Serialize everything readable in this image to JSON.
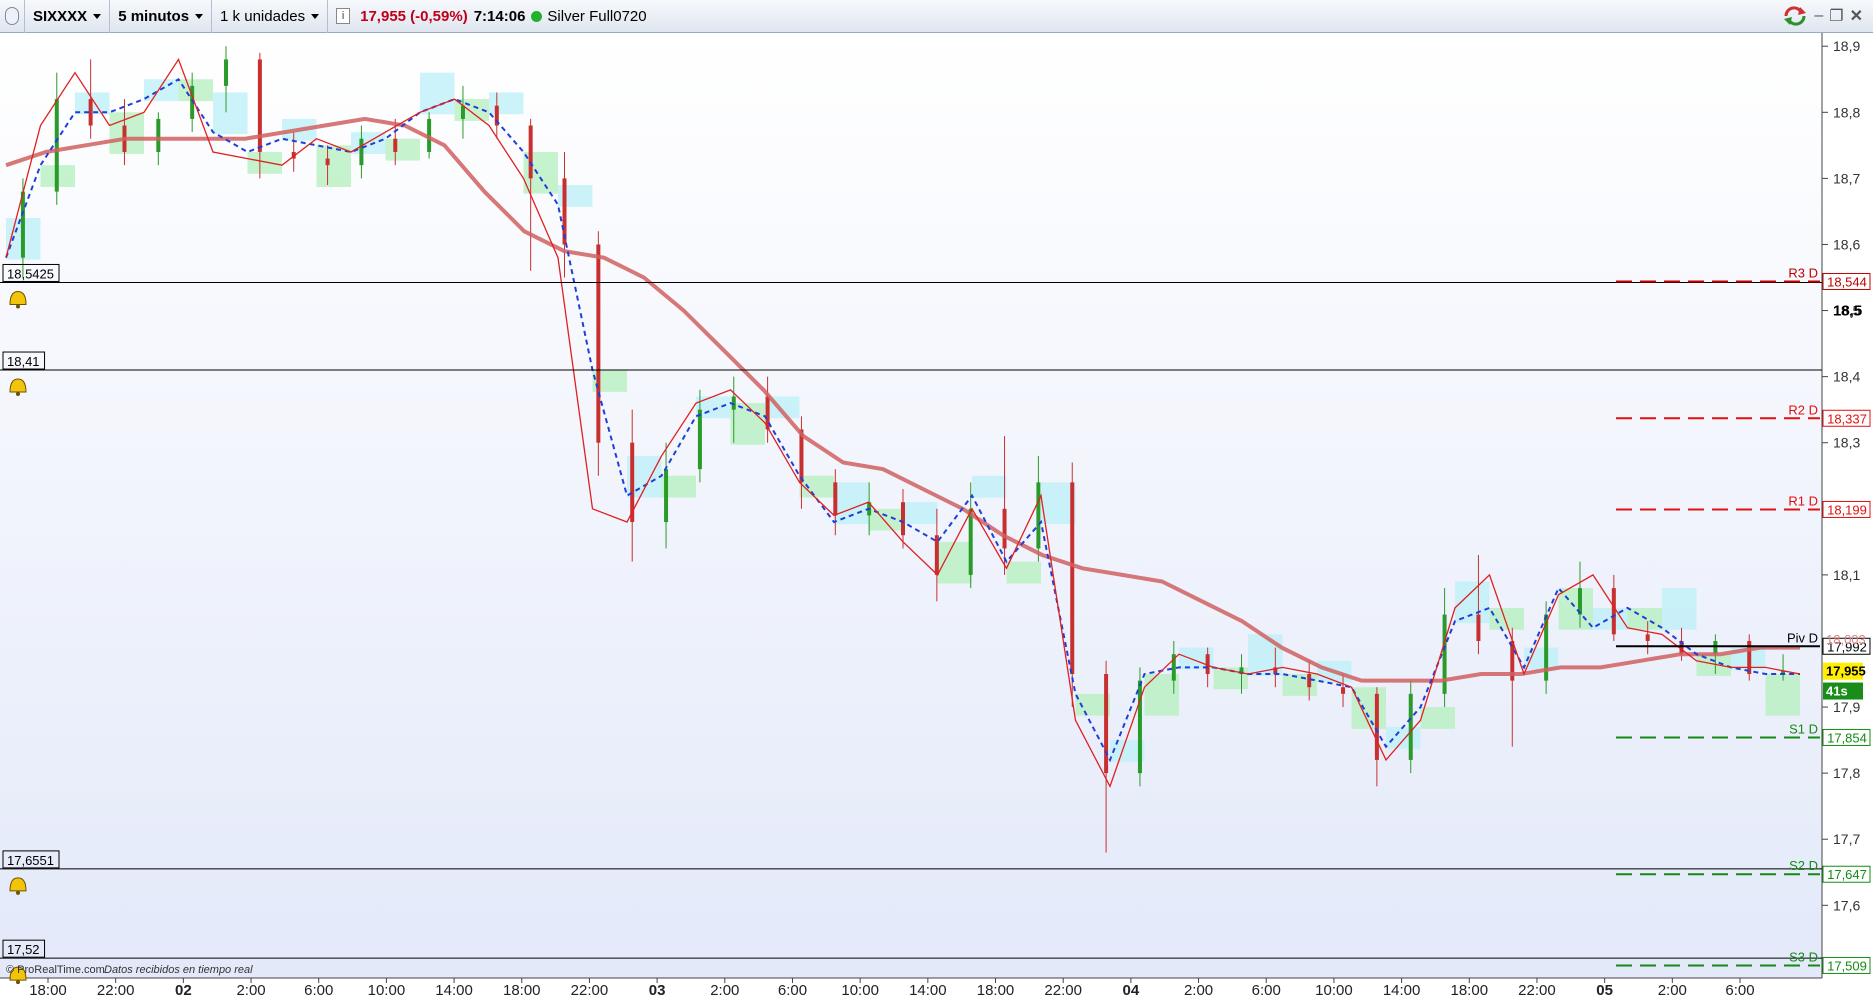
{
  "toolbar": {
    "symbol": "SIXXXX",
    "timeframe": "5 minutos",
    "units": "1 k unidades",
    "last_price": "17,955 (-0,59%)",
    "time": "7:14:06",
    "account": "Silver Full0720"
  },
  "footer": {
    "brand": "© ProRealTime.com",
    "status": "Datos recibidos en tiempo real"
  },
  "chart_data": {
    "type": "line",
    "title": "",
    "xlabel": "",
    "ylabel": "",
    "ylim": [
      17.49,
      18.92
    ],
    "y_ticks": [
      "18,9",
      "18,8",
      "18,7",
      "18,6",
      "18,5",
      "18,4",
      "18,3",
      "18,1",
      "17,9",
      "17,8",
      "17,7",
      "17,6"
    ],
    "y_tick_values": [
      18.9,
      18.8,
      18.7,
      18.6,
      18.5,
      18.4,
      18.3,
      18.1,
      17.9,
      17.8,
      17.7,
      17.6
    ],
    "x_ticks": [
      {
        "label": "18:00",
        "bold": false,
        "i": 0
      },
      {
        "label": "22:00",
        "bold": false,
        "i": 1
      },
      {
        "label": "02",
        "bold": true,
        "i": 2
      },
      {
        "label": "2:00",
        "bold": false,
        "i": 3
      },
      {
        "label": "6:00",
        "bold": false,
        "i": 4
      },
      {
        "label": "10:00",
        "bold": false,
        "i": 5
      },
      {
        "label": "14:00",
        "bold": false,
        "i": 6
      },
      {
        "label": "18:00",
        "bold": false,
        "i": 7
      },
      {
        "label": "22:00",
        "bold": false,
        "i": 8
      },
      {
        "label": "03",
        "bold": true,
        "i": 9
      },
      {
        "label": "2:00",
        "bold": false,
        "i": 10
      },
      {
        "label": "6:00",
        "bold": false,
        "i": 11
      },
      {
        "label": "10:00",
        "bold": false,
        "i": 12
      },
      {
        "label": "14:00",
        "bold": false,
        "i": 13
      },
      {
        "label": "18:00",
        "bold": false,
        "i": 14
      },
      {
        "label": "22:00",
        "bold": false,
        "i": 15
      },
      {
        "label": "04",
        "bold": true,
        "i": 16
      },
      {
        "label": "2:00",
        "bold": false,
        "i": 17
      },
      {
        "label": "6:00",
        "bold": false,
        "i": 18
      },
      {
        "label": "10:00",
        "bold": false,
        "i": 19
      },
      {
        "label": "14:00",
        "bold": false,
        "i": 20
      },
      {
        "label": "18:00",
        "bold": false,
        "i": 21
      },
      {
        "label": "22:00",
        "bold": false,
        "i": 22
      },
      {
        "label": "05",
        "bold": true,
        "i": 23
      },
      {
        "label": "2:00",
        "bold": false,
        "i": 24
      },
      {
        "label": "6:00",
        "bold": false,
        "i": 25
      }
    ],
    "alert_lines": [
      {
        "label": "18,5425",
        "value": 18.5425
      },
      {
        "label": "18,41",
        "value": 18.41
      },
      {
        "label": "17,6551",
        "value": 17.6551
      },
      {
        "label": "17,52",
        "value": 17.52
      }
    ],
    "pivots": [
      {
        "name": "R3 D",
        "value": 18.544,
        "label": "18,544",
        "color": "#c00000"
      },
      {
        "name": "R2 D",
        "value": 18.337,
        "label": "18,337",
        "color": "#e01010"
      },
      {
        "name": "R1 D",
        "value": 18.199,
        "label": "18,199",
        "color": "#e01010"
      },
      {
        "name": "Piv D",
        "value": 17.992,
        "label": "17,992",
        "color": "#000000"
      },
      {
        "name": "S1 D",
        "value": 17.854,
        "label": "17,854",
        "color": "#138a13"
      },
      {
        "name": "S2 D",
        "value": 17.647,
        "label": "17,647",
        "color": "#138a13"
      },
      {
        "name": "S3 D",
        "value": 17.509,
        "label": "17,509",
        "color": "#138a13"
      }
    ],
    "extra_axis_labels": [
      {
        "label": "18,003",
        "value": 18.003,
        "color": "#e08080"
      },
      {
        "label": "17,955",
        "value": 17.955,
        "color": "#000000",
        "bg": "#ffee00"
      },
      {
        "label": "41s",
        "value": 17.925,
        "color": "#ffffff",
        "bg": "#1a8c1a"
      }
    ],
    "series": [
      {
        "name": "",
        "color": "#d06060",
        "style": "thick",
        "values": [
          18.72,
          18.74,
          18.75,
          18.76,
          18.76,
          18.76,
          18.76,
          18.77,
          18.78,
          18.79,
          18.78,
          18.75,
          18.68,
          18.62,
          18.59,
          18.58,
          18.55,
          18.5,
          18.44,
          18.38,
          18.31,
          18.27,
          18.26,
          18.23,
          18.2,
          18.16,
          18.13,
          18.11,
          18.1,
          18.09,
          18.06,
          18.03,
          17.99,
          17.96,
          17.94,
          17.94,
          17.94,
          17.95,
          17.95,
          17.96,
          17.96,
          17.97,
          17.98,
          17.98,
          17.99,
          17.99
        ]
      },
      {
        "name": "",
        "color": "#1f3fd8",
        "style": "dashed",
        "values": [
          18.58,
          18.72,
          18.8,
          18.8,
          18.82,
          18.85,
          18.77,
          18.74,
          18.76,
          18.75,
          18.74,
          18.76,
          18.8,
          18.82,
          18.8,
          18.74,
          18.66,
          18.41,
          18.22,
          18.25,
          18.34,
          18.36,
          18.34,
          18.25,
          18.18,
          18.2,
          18.18,
          18.15,
          18.22,
          18.12,
          18.18,
          17.92,
          17.82,
          17.95,
          17.96,
          17.96,
          17.95,
          17.95,
          17.94,
          17.93,
          17.84,
          17.9,
          18.03,
          18.05,
          17.96,
          18.08,
          18.02,
          18.05,
          18.02,
          17.98,
          17.96,
          17.95,
          17.95
        ]
      },
      {
        "name": "",
        "color": "#e02020",
        "style": "thin",
        "values": [
          18.58,
          18.78,
          18.86,
          18.78,
          18.8,
          18.88,
          18.74,
          18.73,
          18.72,
          18.76,
          18.74,
          18.77,
          18.8,
          18.82,
          18.78,
          18.7,
          18.58,
          18.2,
          18.18,
          18.28,
          18.36,
          18.38,
          18.33,
          18.24,
          18.19,
          18.21,
          18.15,
          18.1,
          18.2,
          18.11,
          18.22,
          17.88,
          17.78,
          17.93,
          17.98,
          17.96,
          17.95,
          17.96,
          17.95,
          17.93,
          17.82,
          17.88,
          18.05,
          18.1,
          17.95,
          18.07,
          18.1,
          18.02,
          18.01,
          17.97,
          17.96,
          17.96,
          17.95
        ]
      }
    ],
    "candles": [
      {
        "o": 18.58,
        "h": 18.7,
        "l": 18.55,
        "c": 18.68
      },
      {
        "o": 18.68,
        "h": 18.86,
        "l": 18.66,
        "c": 18.82
      },
      {
        "o": 18.82,
        "h": 18.88,
        "l": 18.76,
        "c": 18.78
      },
      {
        "o": 18.78,
        "h": 18.82,
        "l": 18.72,
        "c": 18.74
      },
      {
        "o": 18.74,
        "h": 18.8,
        "l": 18.72,
        "c": 18.79
      },
      {
        "o": 18.79,
        "h": 18.86,
        "l": 18.77,
        "c": 18.84
      },
      {
        "o": 18.84,
        "h": 18.9,
        "l": 18.8,
        "c": 18.88
      },
      {
        "o": 18.88,
        "h": 18.89,
        "l": 18.7,
        "c": 18.74
      },
      {
        "o": 18.74,
        "h": 18.77,
        "l": 18.71,
        "c": 18.73
      },
      {
        "o": 18.73,
        "h": 18.75,
        "l": 18.69,
        "c": 18.72
      },
      {
        "o": 18.72,
        "h": 18.78,
        "l": 18.7,
        "c": 18.76
      },
      {
        "o": 18.76,
        "h": 18.79,
        "l": 18.72,
        "c": 18.74
      },
      {
        "o": 18.74,
        "h": 18.8,
        "l": 18.73,
        "c": 18.79
      },
      {
        "o": 18.79,
        "h": 18.84,
        "l": 18.76,
        "c": 18.81
      },
      {
        "o": 18.81,
        "h": 18.83,
        "l": 18.76,
        "c": 18.78
      },
      {
        "o": 18.78,
        "h": 18.79,
        "l": 18.56,
        "c": 18.7
      },
      {
        "o": 18.7,
        "h": 18.74,
        "l": 18.55,
        "c": 18.6
      },
      {
        "o": 18.6,
        "h": 18.62,
        "l": 18.25,
        "c": 18.3
      },
      {
        "o": 18.3,
        "h": 18.35,
        "l": 18.12,
        "c": 18.18
      },
      {
        "o": 18.18,
        "h": 18.3,
        "l": 18.14,
        "c": 18.26
      },
      {
        "o": 18.26,
        "h": 18.38,
        "l": 18.24,
        "c": 18.35
      },
      {
        "o": 18.35,
        "h": 18.4,
        "l": 18.3,
        "c": 18.37
      },
      {
        "o": 18.37,
        "h": 18.4,
        "l": 18.3,
        "c": 18.32
      },
      {
        "o": 18.32,
        "h": 18.34,
        "l": 18.2,
        "c": 18.24
      },
      {
        "o": 18.24,
        "h": 18.26,
        "l": 18.16,
        "c": 18.19
      },
      {
        "o": 18.19,
        "h": 18.24,
        "l": 18.16,
        "c": 18.21
      },
      {
        "o": 18.21,
        "h": 18.23,
        "l": 18.14,
        "c": 18.16
      },
      {
        "o": 18.16,
        "h": 18.2,
        "l": 18.06,
        "c": 18.1
      },
      {
        "o": 18.1,
        "h": 18.24,
        "l": 18.08,
        "c": 18.2
      },
      {
        "o": 18.2,
        "h": 18.31,
        "l": 18.1,
        "c": 18.14
      },
      {
        "o": 18.14,
        "h": 18.28,
        "l": 18.12,
        "c": 18.24
      },
      {
        "o": 18.24,
        "h": 18.27,
        "l": 17.9,
        "c": 17.95
      },
      {
        "o": 17.95,
        "h": 17.97,
        "l": 17.68,
        "c": 17.8
      },
      {
        "o": 17.8,
        "h": 17.96,
        "l": 17.78,
        "c": 17.94
      },
      {
        "o": 17.94,
        "h": 18.0,
        "l": 17.92,
        "c": 17.98
      },
      {
        "o": 17.98,
        "h": 17.99,
        "l": 17.93,
        "c": 17.95
      },
      {
        "o": 17.95,
        "h": 17.98,
        "l": 17.92,
        "c": 17.96
      },
      {
        "o": 17.96,
        "h": 17.99,
        "l": 17.93,
        "c": 17.95
      },
      {
        "o": 17.95,
        "h": 17.97,
        "l": 17.91,
        "c": 17.93
      },
      {
        "o": 17.93,
        "h": 17.95,
        "l": 17.9,
        "c": 17.92
      },
      {
        "o": 17.92,
        "h": 17.93,
        "l": 17.78,
        "c": 17.82
      },
      {
        "o": 17.82,
        "h": 17.94,
        "l": 17.8,
        "c": 17.92
      },
      {
        "o": 17.92,
        "h": 18.08,
        "l": 17.9,
        "c": 18.04
      },
      {
        "o": 18.04,
        "h": 18.13,
        "l": 17.98,
        "c": 18.0
      },
      {
        "o": 18.0,
        "h": 18.02,
        "l": 17.84,
        "c": 17.94
      },
      {
        "o": 17.94,
        "h": 18.06,
        "l": 17.92,
        "c": 18.04
      },
      {
        "o": 18.04,
        "h": 18.12,
        "l": 18.02,
        "c": 18.08
      },
      {
        "o": 18.08,
        "h": 18.1,
        "l": 18.0,
        "c": 18.01
      },
      {
        "o": 18.01,
        "h": 18.03,
        "l": 17.98,
        "c": 18.0
      },
      {
        "o": 18.0,
        "h": 18.02,
        "l": 17.97,
        "c": 17.98
      },
      {
        "o": 17.98,
        "h": 18.01,
        "l": 17.95,
        "c": 18.0
      },
      {
        "o": 18.0,
        "h": 18.01,
        "l": 17.94,
        "c": 17.95
      },
      {
        "o": 17.95,
        "h": 17.98,
        "l": 17.94,
        "c": 17.955
      }
    ]
  }
}
